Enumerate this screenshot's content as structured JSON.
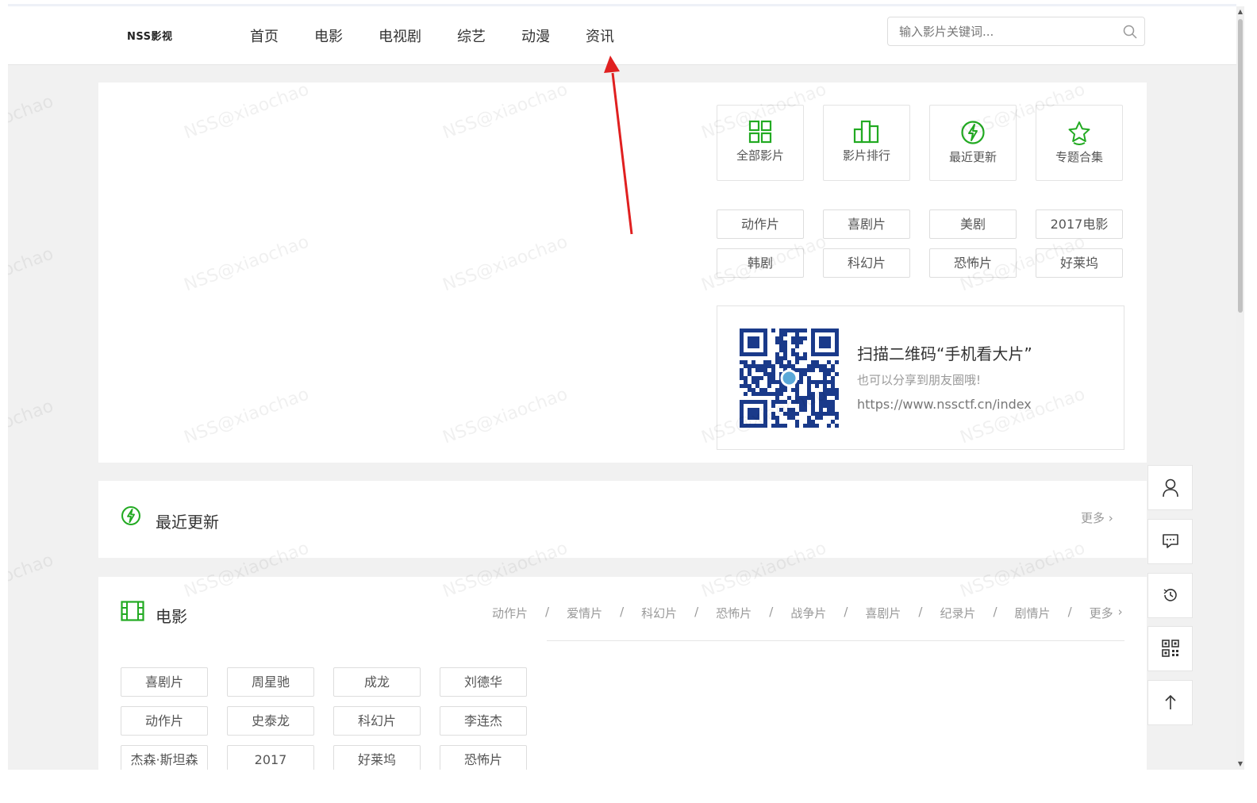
{
  "header": {
    "logo": "NSS影视",
    "nav": [
      "首页",
      "电影",
      "电视剧",
      "综艺",
      "动漫",
      "资讯"
    ],
    "search_placeholder": "输入影片关键词..."
  },
  "quick_links": [
    {
      "label": "全部影片",
      "icon": "grid-icon"
    },
    {
      "label": "影片排行",
      "icon": "bar-chart-icon"
    },
    {
      "label": "最近更新",
      "icon": "lightning-icon"
    },
    {
      "label": "专题合集",
      "icon": "star-icon"
    }
  ],
  "tags": [
    "动作片",
    "喜剧片",
    "美剧",
    "2017电影",
    "韩剧",
    "科幻片",
    "恐怖片",
    "好莱坞"
  ],
  "qr": {
    "title": "扫描二维码“手机看大片”",
    "subtitle": "也可以分享到朋友圈哦!",
    "url": "https://www.nssctf.cn/index"
  },
  "recent": {
    "title": "最近更新",
    "more": "更多"
  },
  "movies": {
    "title": "电影",
    "categories": [
      "动作片",
      "爱情片",
      "科幻片",
      "恐怖片",
      "战争片",
      "喜剧片",
      "纪录片",
      "剧情片",
      "更多"
    ],
    "tags": [
      "喜剧片",
      "周星驰",
      "成龙",
      "刘德华",
      "动作片",
      "史泰龙",
      "科幻片",
      "李连杰",
      "杰森·斯坦森",
      "2017",
      "好莱坞",
      "恐怖片"
    ]
  },
  "watermark": "NSS@xiaochao",
  "watermark_partial": "ochao",
  "sidebar_tools": [
    "user-icon",
    "comment-icon",
    "history-icon",
    "qrcode-icon",
    "back-to-top-icon"
  ],
  "colors": {
    "accent": "#22aa22",
    "arrow": "#e02020"
  }
}
